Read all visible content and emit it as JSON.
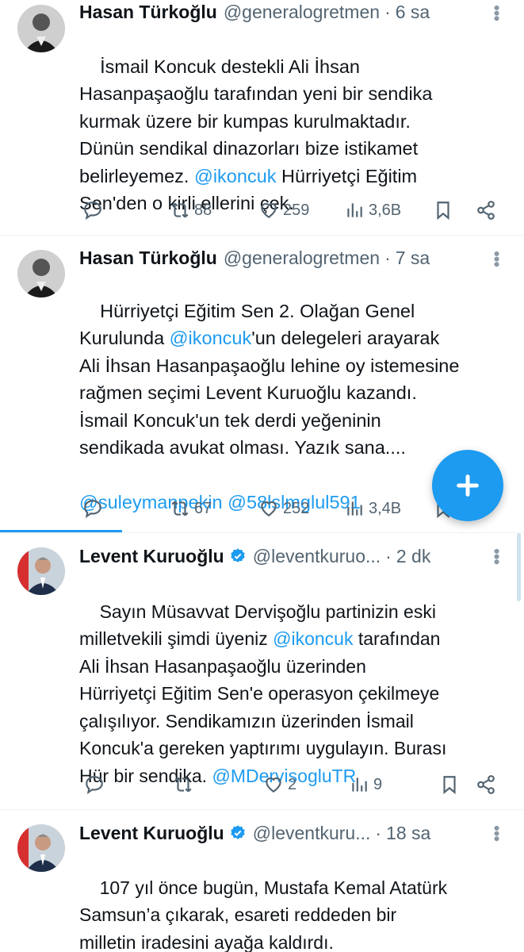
{
  "tweets": [
    {
      "name": "Hasan Türkoğlu",
      "handle": "@generalogretmen",
      "separator": "·",
      "time": "6 sa",
      "verified": false,
      "text_parts": [
        {
          "t": "İsmail Koncuk destekli Ali İhsan\nHasanpaşaoğlu tarafından yeni bir sendika\nkurmak üzere bir kumpas kurulmaktadır.\nDünün sendikal dinazorları bize istikamet\nbelirleyemez. "
        },
        {
          "t": "@ikoncuk",
          "mention": true
        },
        {
          "t": " Hürriyetçi Eğitim\nSen'den o kirli ellerini çek."
        }
      ],
      "reply_count": "",
      "retweet_count": "88",
      "like_count": "259",
      "view_count": "3,6B"
    },
    {
      "name": "Hasan Türkoğlu",
      "handle": "@generalogretmen",
      "separator": "·",
      "time": "7 sa",
      "verified": false,
      "text_parts": [
        {
          "t": "Hürriyetçi Eğitim Sen 2. Olağan Genel\nKurulunda "
        },
        {
          "t": "@ikoncuk",
          "mention": true
        },
        {
          "t": "'un delegeleri arayarak\nAli İhsan Hasanpaşaoğlu lehine oy istemesine\nrağmen seçimi Levent Kuruoğlu kazandı.\nİsmail Koncuk'un tek derdi yeğeninin\nsendikada avukat olması. Yazık sana....\n\n"
        },
        {
          "t": "@suleymanpekin @58lslmglul591",
          "mention": true
        }
      ],
      "reply_count": "",
      "retweet_count": "67",
      "like_count": "252",
      "view_count": "3,4B"
    },
    {
      "name": "Levent Kuruoğlu",
      "handle": "@leventkuruo...",
      "separator": "·",
      "time": "2 dk",
      "verified": true,
      "text_parts": [
        {
          "t": "Sayın Müsavvat Dervişoğlu partinizin eski\nmilletvekili şimdi üyeniz "
        },
        {
          "t": "@ikoncuk",
          "mention": true
        },
        {
          "t": " tarafından\nAli İhsan Hasanpaşaoğlu üzerinden\nHürriyetçi Eğitim Sen'e operasyon çekilmeye\nçalışılıyor. Sendikamızın üzerinden İsmail\nKoncuk'a gereken yaptırımı uygulayın. Burası\nHür bir sendika. "
        },
        {
          "t": "@MDervisogluTR",
          "mention": true
        }
      ],
      "reply_count": "",
      "retweet_count": "",
      "like_count": "2",
      "view_count": "9"
    },
    {
      "name": "Levent Kuruoğlu",
      "handle": "@leventkuru...",
      "separator": "·",
      "time": "18 sa",
      "verified": true,
      "text_parts": [
        {
          "t": "107 yıl önce bugün, Mustafa Kemal Atatürk\nSamsun’a çıkarak, esareti reddeden bir\nmilletin iradesini ayağa kaldırdı."
        }
      ]
    }
  ],
  "icons": {
    "reply": "reply-icon",
    "retweet": "retweet-icon",
    "like": "heart-icon",
    "views": "views-icon",
    "bookmark": "bookmark-icon",
    "share": "share-icon",
    "compose": "plus-icon",
    "more": "more-icon",
    "verified": "verified-badge-icon"
  },
  "colors": {
    "accent": "#1d9bf0",
    "text": "#0f1419",
    "secondary": "#536471"
  }
}
